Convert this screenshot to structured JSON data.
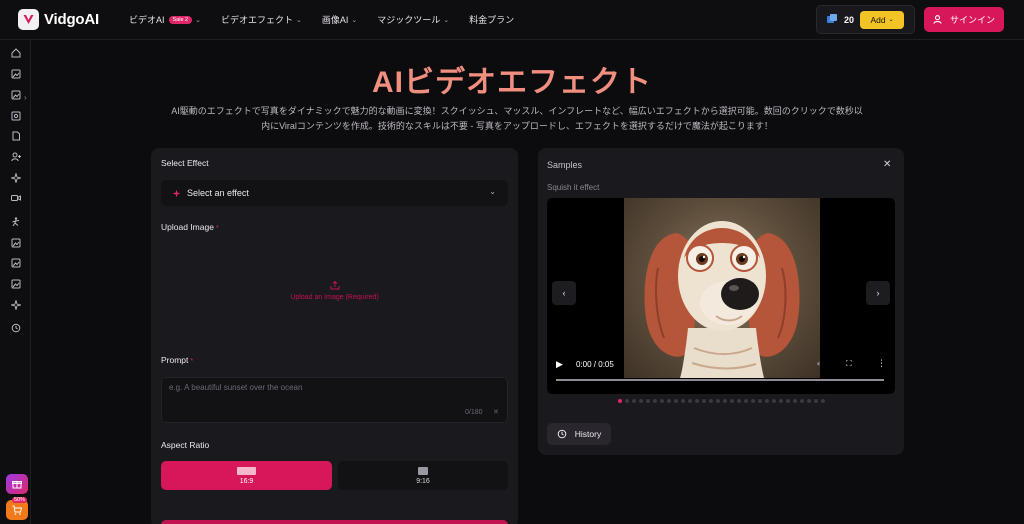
{
  "header": {
    "brand": "VidgoAI",
    "nav": [
      {
        "label": "ビデオAI",
        "badge": "Sale 2",
        "icon": "chevron-down-icon"
      },
      {
        "label": "ビデオエフェクト",
        "icon": "chevron-down-icon"
      },
      {
        "label": "画像AI",
        "icon": "chevron-down-icon"
      },
      {
        "label": "マジックツール",
        "icon": "chevron-down-icon"
      },
      {
        "label": "料金プラン"
      }
    ],
    "credits": "20",
    "add_label": "Add",
    "signin_label": "サインイン"
  },
  "page": {
    "title": "AIビデオエフェクト",
    "description_line1": "AI駆動のエフェクトで写真をダイナミックで魅力的な動画に変換！スクイッシュ、マッスル、インフレートなど、幅広いエフェクトから選択可能。数回のクリックで数秒以",
    "description_line2": "内にViralコンテンツを作成。技術的なスキルは不要 - 写真をアップロードし、エフェクトを選択するだけで魔法が起こります！"
  },
  "form": {
    "select_effect_label": "Select Effect",
    "select_placeholder": "Select an effect",
    "upload_label": "Upload Image",
    "required_mark": "*",
    "upload_hint": "Upload an Image (Required)",
    "prompt_label": "Prompt",
    "prompt_placeholder": "e.g. A beautiful sunset over the ocean",
    "prompt_count": "0/180",
    "aspect_label": "Aspect Ratio",
    "aspect_options": [
      "16:9",
      "9:16"
    ],
    "aspect_selected": "16:9"
  },
  "samples": {
    "title": "Samples",
    "effect_name": "Squish it effect",
    "time": "0:00 / 0:05",
    "progress": 0,
    "carousel_count": 30,
    "carousel_active": 0,
    "history_label": "History"
  },
  "sidebar": {
    "icons": [
      "home-icon",
      "image-icon",
      "image-icon",
      "image-icon",
      "document-icon",
      "user-plus-icon",
      "sparkle-icon",
      "video-camera-icon",
      "dancing-icon",
      "image-icon",
      "image-icon",
      "image-icon",
      "sparkle-icon",
      "history-icon"
    ],
    "promo_badge": "50%"
  },
  "colors": {
    "accent": "#d8175a",
    "title_gradient": "#f08e80",
    "credits_button": "#f2c425",
    "cart_button": "#f27a1a"
  }
}
